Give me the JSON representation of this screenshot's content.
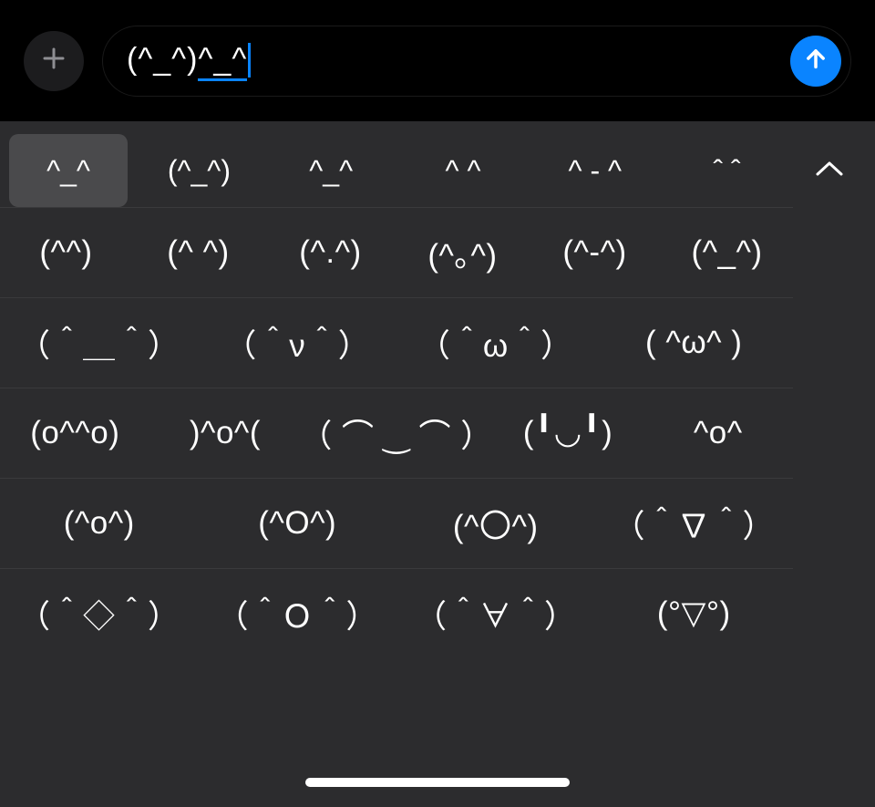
{
  "compose": {
    "input_committed": "(^_^)",
    "input_composing": "^_^",
    "send_icon": "arrow-up",
    "plus_icon": "plus"
  },
  "suggestions": {
    "highlighted": "^_^",
    "items": [
      "(^_^)",
      "^_^",
      "^ ^",
      "^ - ^",
      "ˆ  ˆ"
    ],
    "expand_icon": "chevron-up"
  },
  "candidate_rows": [
    [
      "(^^)",
      "(^ ^)",
      "(^.^)",
      "(^｡^)",
      "(^-^)",
      "(^_^)"
    ],
    [
      "（＾＿＾）",
      "（＾ν＾）",
      "（＾ω＾）",
      "( ^ω^ )"
    ],
    [
      "(o^^o)",
      ")^o^(",
      "（ ⌒ ‿ ⌒ ）",
      "(╹◡╹)",
      "^o^"
    ],
    [
      "(^o^)",
      "(^O^)",
      "(^〇^)",
      "（＾∇＾）"
    ],
    [
      "（＾◇＾）",
      "（＾Ｏ＾）",
      "（＾∀＾）",
      "(°▽°)"
    ]
  ],
  "bottom": {
    "globe_icon": "globe",
    "mic_icon": "microphone",
    "home_indicator": "home-indicator"
  },
  "colors": {
    "accent_blue": "#0A84FF",
    "keyboard_bg": "#2c2c2e",
    "highlight_bg": "#4a4a4c"
  }
}
